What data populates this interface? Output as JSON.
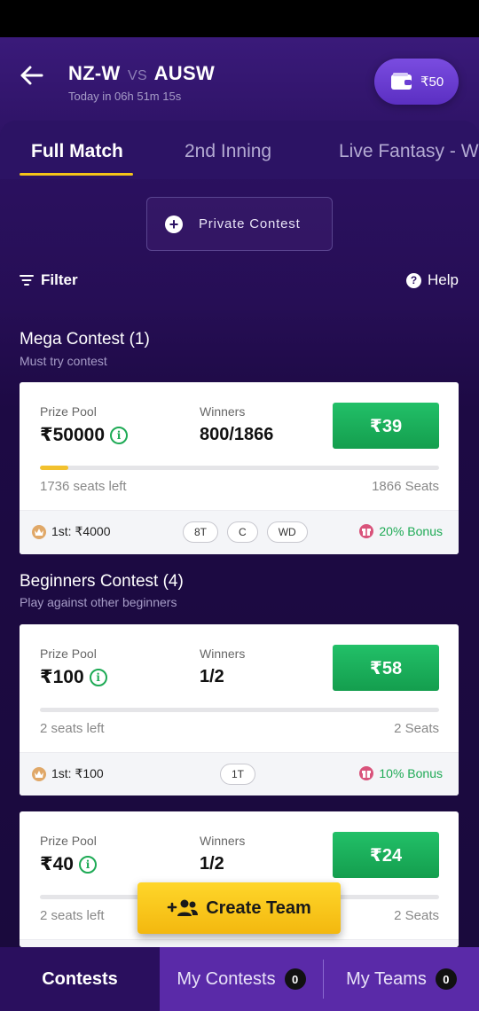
{
  "header": {
    "team1": "NZ-W",
    "vs": "VS",
    "team2": "AUSW",
    "countdown": "Today in 06h 51m 15s",
    "wallet_amount": "₹50"
  },
  "tabs": [
    {
      "label": "Full Match",
      "active": true
    },
    {
      "label": "2nd Inning",
      "active": false
    },
    {
      "label": "Live Fantasy - W",
      "active": false
    }
  ],
  "actions": {
    "private_contest": "Private Contest",
    "filter": "Filter",
    "help": "Help"
  },
  "sections": [
    {
      "title": "Mega Contest (1)",
      "subtitle": "Must try contest",
      "contests": [
        {
          "prize_label": "Prize Pool",
          "prize": "₹50000",
          "winners_label": "Winners",
          "winners": "800/1866",
          "entry": "₹39",
          "fill_fraction": 0.07,
          "seats_left": "1736 seats left",
          "seats_total": "1866 Seats",
          "first_prize": "1st: ₹4000",
          "tags": [
            "8T",
            "C",
            "WD"
          ],
          "bonus": "20% Bonus"
        }
      ]
    },
    {
      "title": "Beginners Contest (4)",
      "subtitle": "Play against other beginners",
      "contests": [
        {
          "prize_label": "Prize Pool",
          "prize": "₹100",
          "winners_label": "Winners",
          "winners": "1/2",
          "entry": "₹58",
          "fill_fraction": 0.0,
          "seats_left": "2 seats left",
          "seats_total": "2 Seats",
          "first_prize": "1st: ₹100",
          "tags": [
            "1T"
          ],
          "bonus": "10% Bonus"
        },
        {
          "prize_label": "Prize Pool",
          "prize": "₹40",
          "winners_label": "Winners",
          "winners": "1/2",
          "entry": "₹24",
          "seats_left": "2 seats left",
          "seats_total": "2 Seats"
        }
      ]
    }
  ],
  "create_team": "Create Team",
  "bottom_nav": [
    {
      "label": "Contests",
      "active": true
    },
    {
      "label": "My Contests",
      "count": "0"
    },
    {
      "label": "My Teams",
      "count": "0"
    }
  ],
  "colors": {
    "accent_yellow": "#f5c518",
    "entry_green": "#1eaa55",
    "header_purple": "#2c1364",
    "nav_purple": "#5a2aa8"
  }
}
